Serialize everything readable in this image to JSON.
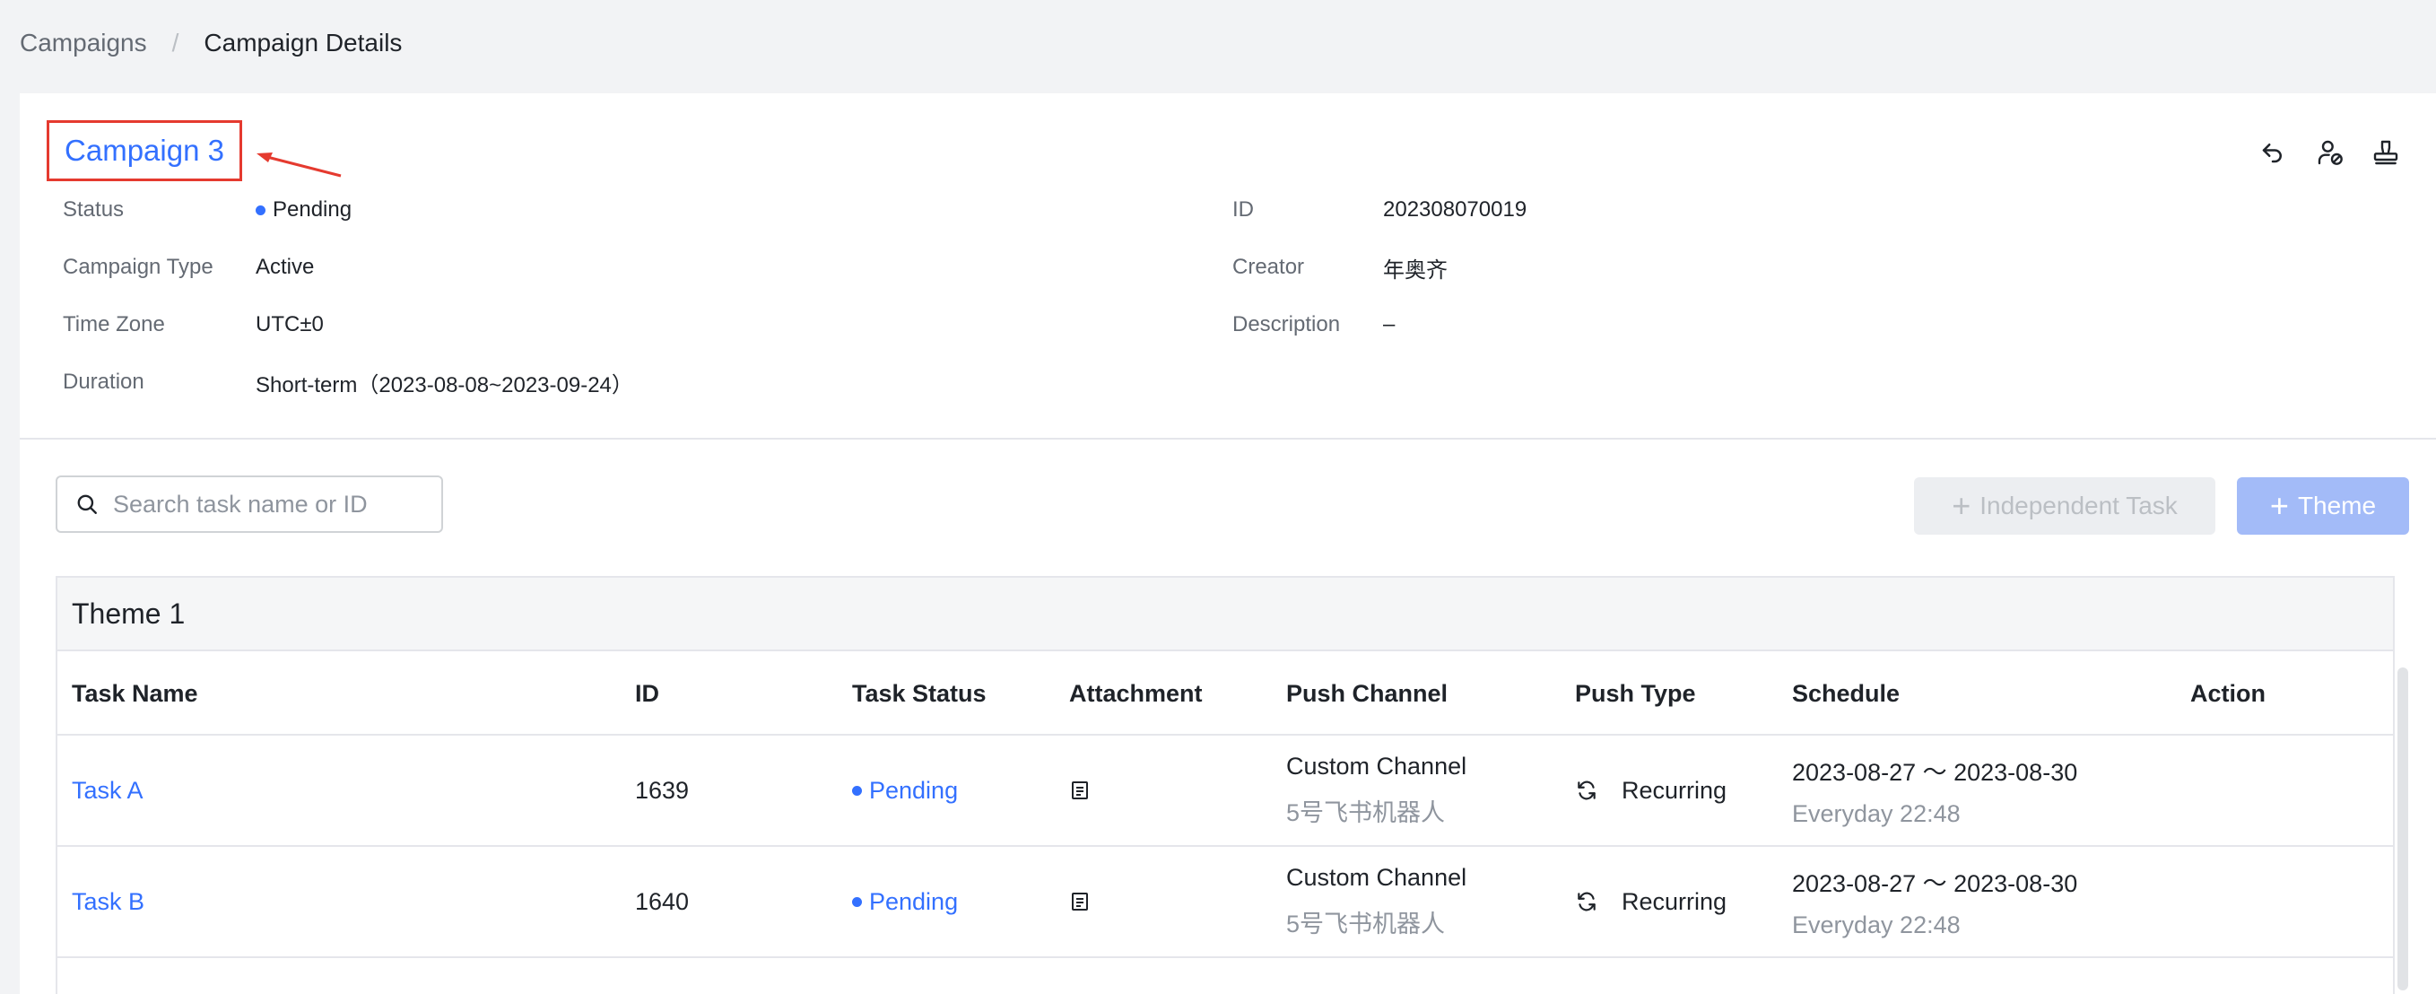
{
  "breadcrumb": {
    "parent": "Campaigns",
    "separator": "/",
    "current": "Campaign Details"
  },
  "campaign": {
    "title": "Campaign 3",
    "fields_left": [
      {
        "label": "Status",
        "value": "Pending"
      },
      {
        "label": "Campaign Type",
        "value": "Active"
      },
      {
        "label": "Time Zone",
        "value": "UTC±0"
      },
      {
        "label": "Duration",
        "value": "Short-term（2023-08-08~2023-09-24）"
      }
    ],
    "fields_right": [
      {
        "label": "ID",
        "value": "202308070019"
      },
      {
        "label": "Creator",
        "value": "年奥齐"
      },
      {
        "label": "Description",
        "value": "–"
      }
    ]
  },
  "header_actions": [
    "undo-icon",
    "user-disable-icon",
    "stamp-icon"
  ],
  "search": {
    "placeholder": "Search task name or ID",
    "value": ""
  },
  "buttons": {
    "independent_task": "Independent Task",
    "theme": "Theme"
  },
  "table": {
    "theme_name": "Theme 1",
    "columns": [
      "Task Name",
      "ID",
      "Task Status",
      "Attachment",
      "Push Channel",
      "Push Type",
      "Schedule",
      "Action"
    ],
    "rows": [
      {
        "name": "Task A",
        "id": "1639",
        "status": "Pending",
        "channel": "Custom Channel",
        "channel_sub": "5号飞书机器人",
        "push_type": "Recurring",
        "schedule": "2023-08-27 ～ 2023-08-30",
        "schedule_sub": "Everyday 22:48"
      },
      {
        "name": "Task B",
        "id": "1640",
        "status": "Pending",
        "channel": "Custom Channel",
        "channel_sub": "5号飞书机器人",
        "push_type": "Recurring",
        "schedule": "2023-08-27 ～ 2023-08-30",
        "schedule_sub": "Everyday 22:48"
      }
    ]
  },
  "colors": {
    "accent": "#3370ff",
    "annotation": "#e53a2f",
    "theme_button": "#a3bbf8"
  }
}
